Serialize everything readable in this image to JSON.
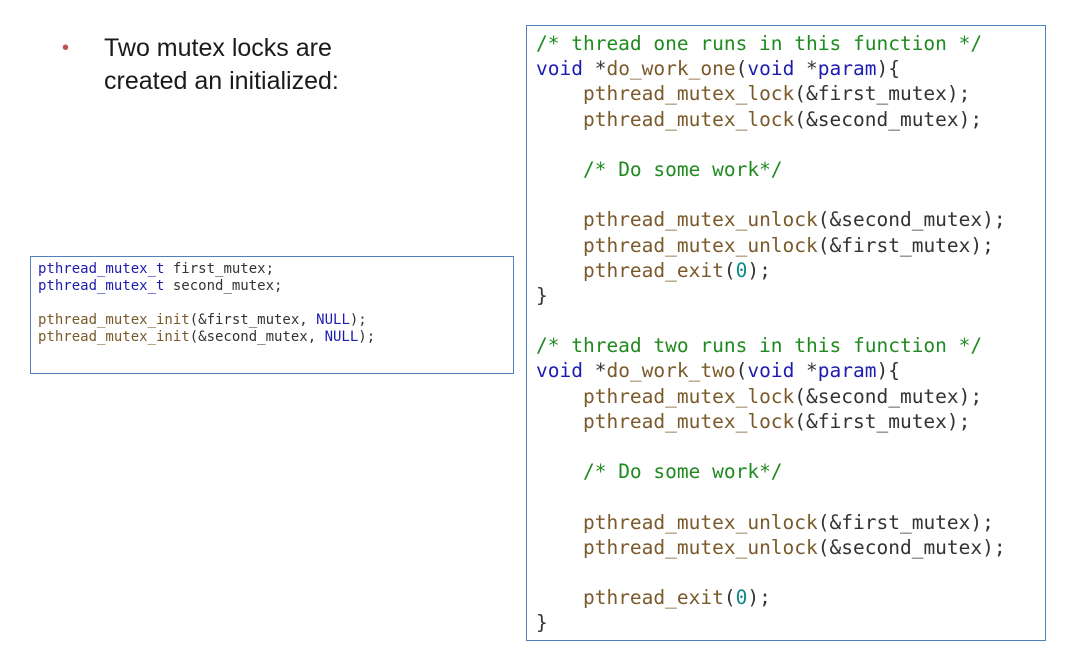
{
  "bullet": {
    "marker": "•",
    "text": "Two mutex locks are\ncreated an initialized:"
  },
  "code_declarations": {
    "lines": [
      [
        {
          "t": "pthread_mutex_t",
          "c": "kw"
        },
        {
          "t": " first_mutex;",
          "c": "pl"
        }
      ],
      [
        {
          "t": "pthread_mutex_t",
          "c": "kw"
        },
        {
          "t": " second_mutex;",
          "c": "pl"
        }
      ],
      [],
      [
        {
          "t": "pthread_mutex_init",
          "c": "fn"
        },
        {
          "t": "(&first_mutex, ",
          "c": "pl"
        },
        {
          "t": "NULL",
          "c": "kw"
        },
        {
          "t": ");",
          "c": "pl"
        }
      ],
      [
        {
          "t": "pthread_mutex_init",
          "c": "fn"
        },
        {
          "t": "(&second_mutex, ",
          "c": "pl"
        },
        {
          "t": "NULL",
          "c": "kw"
        },
        {
          "t": ");",
          "c": "pl"
        }
      ]
    ]
  },
  "code_threads": {
    "lines": [
      [
        {
          "t": "/* thread one runs in this function */",
          "c": "cm"
        }
      ],
      [
        {
          "t": "void",
          "c": "kw"
        },
        {
          "t": " *",
          "c": "pl"
        },
        {
          "t": "do_work_one",
          "c": "fn"
        },
        {
          "t": "(",
          "c": "pl"
        },
        {
          "t": "void",
          "c": "kw"
        },
        {
          "t": " *",
          "c": "pl"
        },
        {
          "t": "param",
          "c": "kw"
        },
        {
          "t": "){",
          "c": "pl"
        }
      ],
      [
        {
          "t": "    ",
          "c": "pl"
        },
        {
          "t": "pthread_mutex_lock",
          "c": "fn"
        },
        {
          "t": "(&first_mutex);",
          "c": "pl"
        }
      ],
      [
        {
          "t": "    ",
          "c": "pl"
        },
        {
          "t": "pthread_mutex_lock",
          "c": "fn"
        },
        {
          "t": "(&second_mutex);",
          "c": "pl"
        }
      ],
      [],
      [
        {
          "t": "    ",
          "c": "pl"
        },
        {
          "t": "/* Do some work*/",
          "c": "cm"
        }
      ],
      [],
      [
        {
          "t": "    ",
          "c": "pl"
        },
        {
          "t": "pthread_mutex_unlock",
          "c": "fn"
        },
        {
          "t": "(&second_mutex);",
          "c": "pl"
        }
      ],
      [
        {
          "t": "    ",
          "c": "pl"
        },
        {
          "t": "pthread_mutex_unlock",
          "c": "fn"
        },
        {
          "t": "(&first_mutex);",
          "c": "pl"
        }
      ],
      [
        {
          "t": "    ",
          "c": "pl"
        },
        {
          "t": "pthread_exit",
          "c": "fn"
        },
        {
          "t": "(",
          "c": "pl"
        },
        {
          "t": "0",
          "c": "num"
        },
        {
          "t": ");",
          "c": "pl"
        }
      ],
      [
        {
          "t": "}",
          "c": "pl"
        }
      ],
      [],
      [
        {
          "t": "/* thread two runs in this function */",
          "c": "cm"
        }
      ],
      [
        {
          "t": "void",
          "c": "kw"
        },
        {
          "t": " *",
          "c": "pl"
        },
        {
          "t": "do_work_two",
          "c": "fn"
        },
        {
          "t": "(",
          "c": "pl"
        },
        {
          "t": "void",
          "c": "kw"
        },
        {
          "t": " *",
          "c": "pl"
        },
        {
          "t": "param",
          "c": "kw"
        },
        {
          "t": "){",
          "c": "pl"
        }
      ],
      [
        {
          "t": "    ",
          "c": "pl"
        },
        {
          "t": "pthread_mutex_lock",
          "c": "fn"
        },
        {
          "t": "(&second_mutex);",
          "c": "pl"
        }
      ],
      [
        {
          "t": "    ",
          "c": "pl"
        },
        {
          "t": "pthread_mutex_lock",
          "c": "fn"
        },
        {
          "t": "(&first_mutex);",
          "c": "pl"
        }
      ],
      [],
      [
        {
          "t": "    ",
          "c": "pl"
        },
        {
          "t": "/* Do some work*/",
          "c": "cm"
        }
      ],
      [],
      [
        {
          "t": "    ",
          "c": "pl"
        },
        {
          "t": "pthread_mutex_unlock",
          "c": "fn"
        },
        {
          "t": "(&first_mutex);",
          "c": "pl"
        }
      ],
      [
        {
          "t": "    ",
          "c": "pl"
        },
        {
          "t": "pthread_mutex_unlock",
          "c": "fn"
        },
        {
          "t": "(&second_mutex);",
          "c": "pl"
        }
      ],
      [],
      [
        {
          "t": "    ",
          "c": "pl"
        },
        {
          "t": "pthread_exit",
          "c": "fn"
        },
        {
          "t": "(",
          "c": "pl"
        },
        {
          "t": "0",
          "c": "num"
        },
        {
          "t": ");",
          "c": "pl"
        }
      ],
      [
        {
          "t": "}",
          "c": "pl"
        }
      ]
    ]
  },
  "colors": {
    "bullet_marker": "#c0504d",
    "box_border": "#4f81bd",
    "keyword": "#1c1cb0",
    "function": "#7a5a2a",
    "comment": "#1f8a1f",
    "number": "#0d8a8a"
  }
}
